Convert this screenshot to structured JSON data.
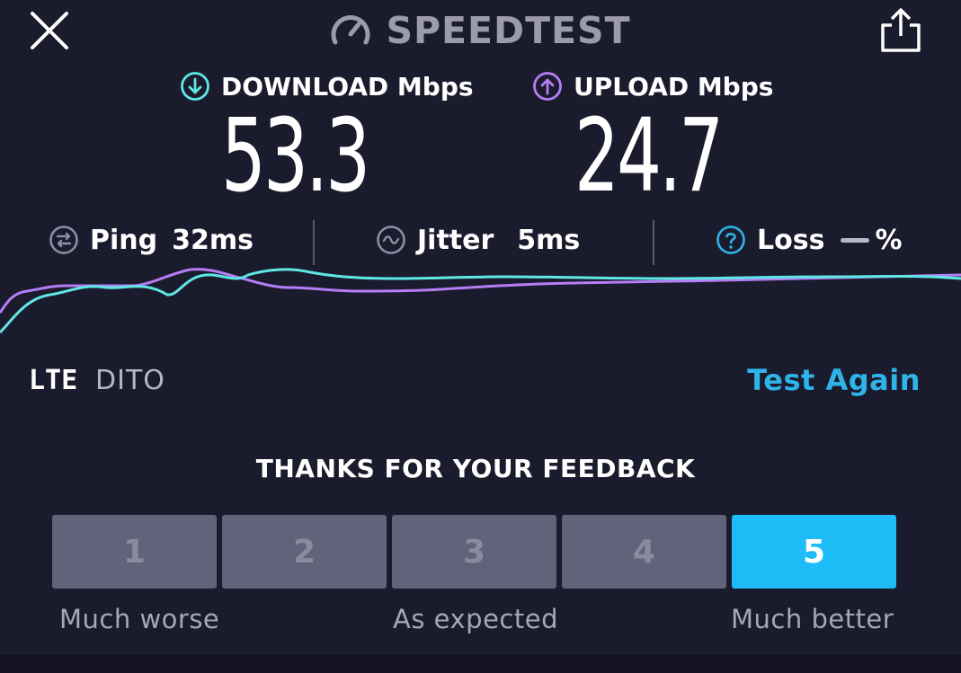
{
  "header": {
    "logo_text": "SPEEDTEST",
    "close_icon": "close-icon",
    "share_icon": "share-icon"
  },
  "download": {
    "label": "DOWNLOAD Mbps",
    "value": "53.3",
    "color": "#5ee7e4"
  },
  "upload": {
    "label": "UPLOAD Mbps",
    "value": "24.7",
    "color": "#b57ef5"
  },
  "stats": {
    "ping": {
      "label": "Ping",
      "value": "32ms"
    },
    "jitter": {
      "label": "Jitter",
      "value": "5ms"
    },
    "loss": {
      "label": "Loss",
      "value": "%"
    }
  },
  "connection": {
    "type": "LTE",
    "carrier": "DITO"
  },
  "actions": {
    "test_again": "Test Again"
  },
  "feedback": {
    "title": "THANKS FOR YOUR FEEDBACK",
    "options": [
      "1",
      "2",
      "3",
      "4",
      "5"
    ],
    "selected": "5",
    "labels": {
      "low": "Much worse",
      "mid": "As expected",
      "high": "Much better"
    }
  },
  "colors": {
    "background": "#1b1b2e",
    "accent": "#1ebdf7",
    "button_inactive": "#62627a"
  }
}
